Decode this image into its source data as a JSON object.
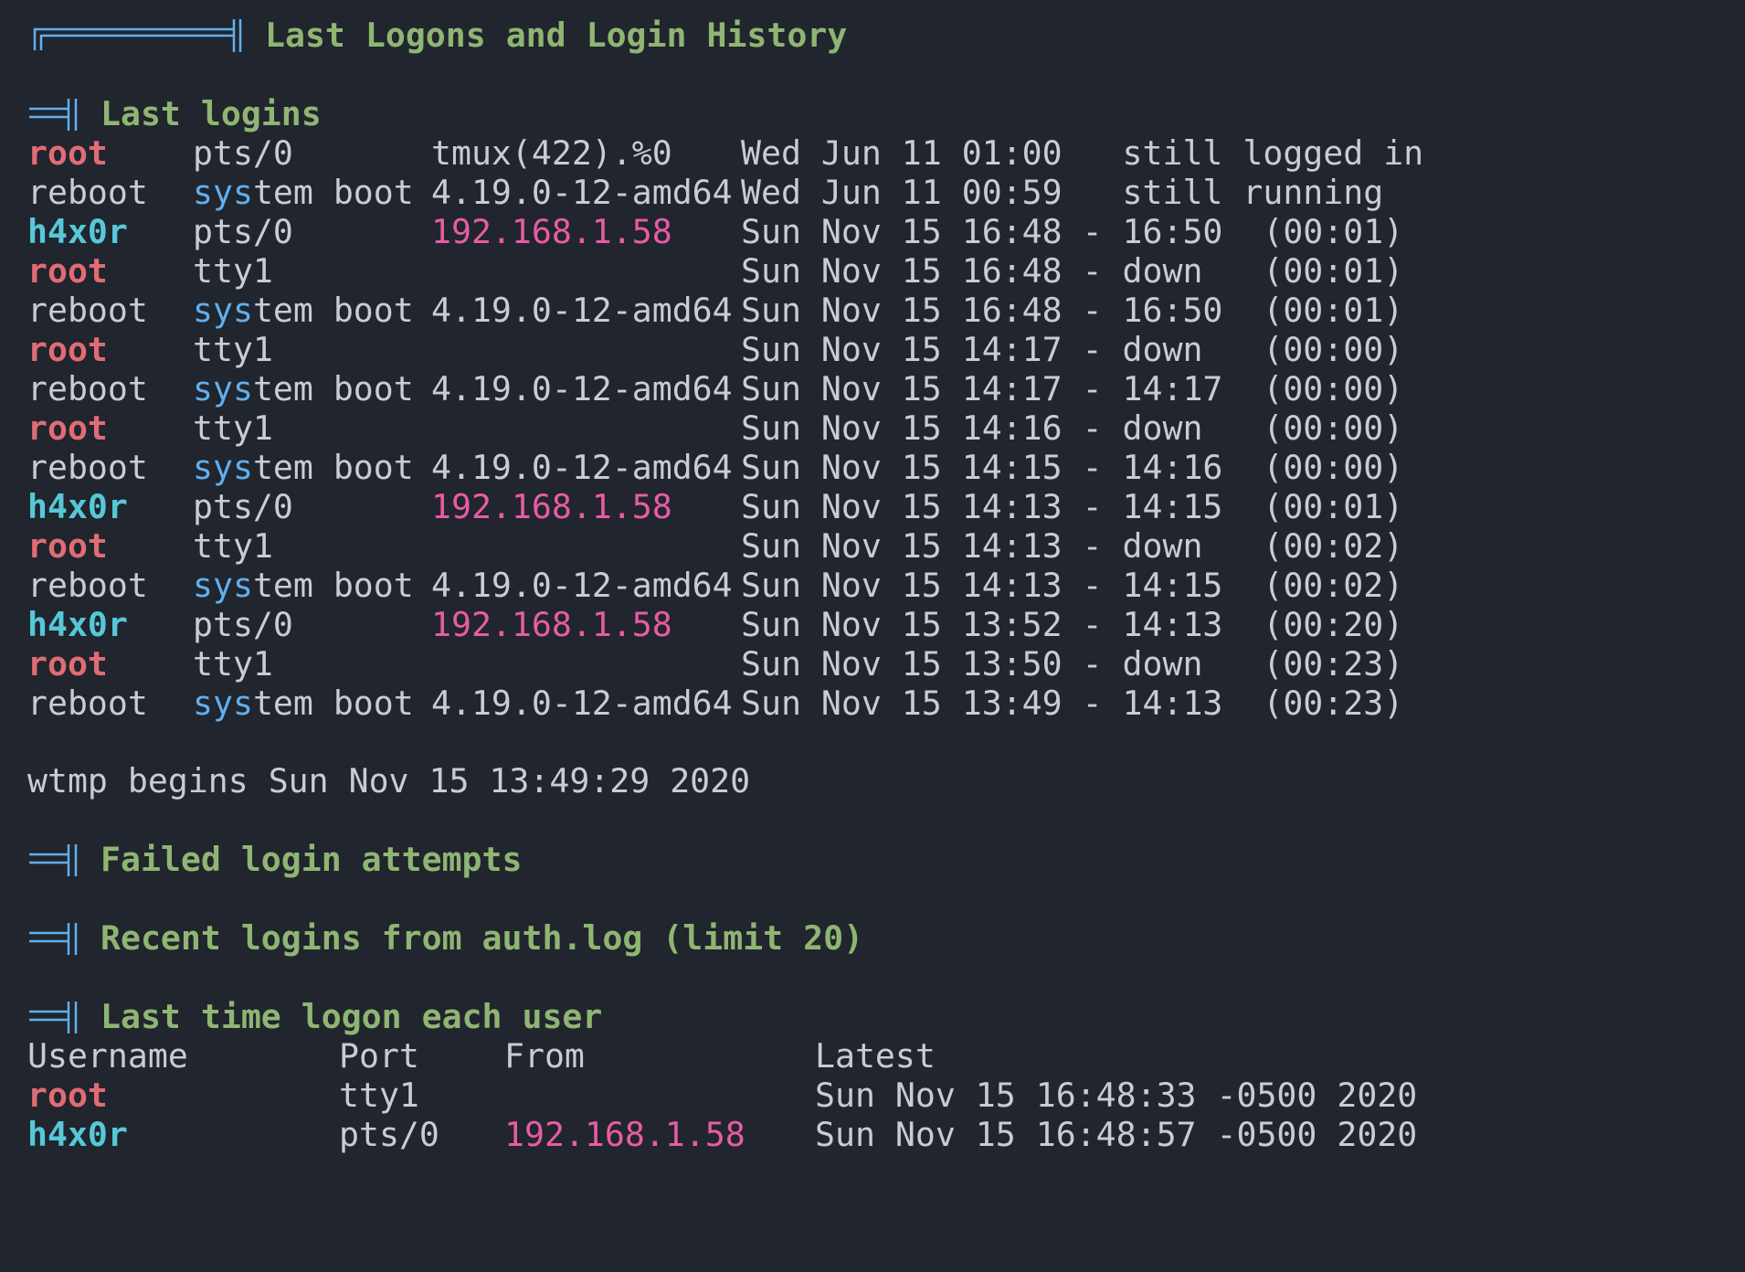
{
  "title": "Last Logons and Login History",
  "sections": {
    "last_logins": "Last logins",
    "failed": "Failed login attempts",
    "recent": "Recent logins from auth.log (limit 20)",
    "last_time": "Last time logon each user"
  },
  "last_logins": [
    {
      "user": "root",
      "tty": "pts/0",
      "host": "tmux(422).%0",
      "time": "Wed Jun 11 01:00   still logged in"
    },
    {
      "user": "reboot",
      "tty": "system boot",
      "host": "4.19.0-12-amd64",
      "time": "Wed Jun 11 00:59   still running"
    },
    {
      "user": "h4x0r",
      "tty": "pts/0",
      "host": "192.168.1.58",
      "time": "Sun Nov 15 16:48 - 16:50  (00:01)"
    },
    {
      "user": "root",
      "tty": "tty1",
      "host": "",
      "time": "Sun Nov 15 16:48 - down   (00:01)"
    },
    {
      "user": "reboot",
      "tty": "system boot",
      "host": "4.19.0-12-amd64",
      "time": "Sun Nov 15 16:48 - 16:50  (00:01)"
    },
    {
      "user": "root",
      "tty": "tty1",
      "host": "",
      "time": "Sun Nov 15 14:17 - down   (00:00)"
    },
    {
      "user": "reboot",
      "tty": "system boot",
      "host": "4.19.0-12-amd64",
      "time": "Sun Nov 15 14:17 - 14:17  (00:00)"
    },
    {
      "user": "root",
      "tty": "tty1",
      "host": "",
      "time": "Sun Nov 15 14:16 - down   (00:00)"
    },
    {
      "user": "reboot",
      "tty": "system boot",
      "host": "4.19.0-12-amd64",
      "time": "Sun Nov 15 14:15 - 14:16  (00:00)"
    },
    {
      "user": "h4x0r",
      "tty": "pts/0",
      "host": "192.168.1.58",
      "time": "Sun Nov 15 14:13 - 14:15  (00:01)"
    },
    {
      "user": "root",
      "tty": "tty1",
      "host": "",
      "time": "Sun Nov 15 14:13 - down   (00:02)"
    },
    {
      "user": "reboot",
      "tty": "system boot",
      "host": "4.19.0-12-amd64",
      "time": "Sun Nov 15 14:13 - 14:15  (00:02)"
    },
    {
      "user": "h4x0r",
      "tty": "pts/0",
      "host": "192.168.1.58",
      "time": "Sun Nov 15 13:52 - 14:13  (00:20)"
    },
    {
      "user": "root",
      "tty": "tty1",
      "host": "",
      "time": "Sun Nov 15 13:50 - down   (00:23)"
    },
    {
      "user": "reboot",
      "tty": "system boot",
      "host": "4.19.0-12-amd64",
      "time": "Sun Nov 15 13:49 - 14:13  (00:23)"
    }
  ],
  "wtmp": "wtmp begins Sun Nov 15 13:49:29 2020",
  "lastlog": {
    "headers": {
      "username": "Username",
      "port": "Port",
      "from": "From",
      "latest": "Latest"
    },
    "rows": [
      {
        "user": "root",
        "port": "tty1",
        "from": "",
        "latest": "Sun Nov 15 16:48:33 -0500 2020"
      },
      {
        "user": "h4x0r",
        "port": "pts/0",
        "from": "192.168.1.58",
        "latest": "Sun Nov 15 16:48:57 -0500 2020"
      }
    ]
  },
  "colors": {
    "background": "#21252d",
    "text": "#c8ccd4",
    "header": "#8fb573",
    "root": "#e06c75",
    "user": "#56c8d8",
    "system": "#61afef",
    "ip": "#e85ca4",
    "icon": "#61afef"
  }
}
